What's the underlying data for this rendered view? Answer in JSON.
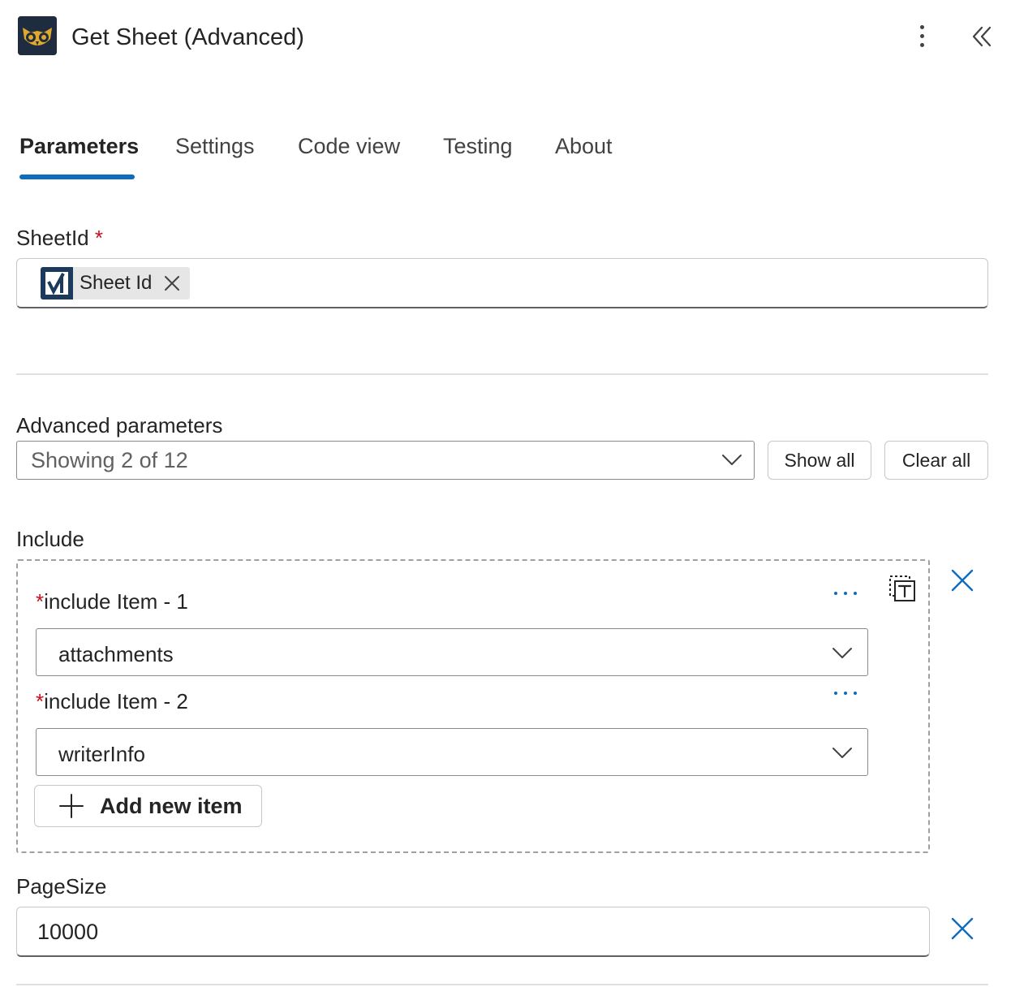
{
  "header": {
    "title": "Get Sheet (Advanced)",
    "app_icon": "owl-logo-icon",
    "more_icon": "more-vertical-icon",
    "collapse_icon": "double-chevron-left-icon"
  },
  "tabs": [
    {
      "label": "Parameters",
      "active": true
    },
    {
      "label": "Settings",
      "active": false
    },
    {
      "label": "Code view",
      "active": false
    },
    {
      "label": "Testing",
      "active": false
    },
    {
      "label": "About",
      "active": false
    }
  ],
  "sheet_id": {
    "label": "SheetId",
    "required_mark": "*",
    "token_label": "Sheet Id",
    "token_icon": "smartsheet-icon"
  },
  "advanced": {
    "label": "Advanced parameters",
    "dropdown_value": "Showing 2 of 12",
    "show_all_label": "Show all",
    "clear_all_label": "Clear all"
  },
  "include": {
    "label": "Include",
    "items": [
      {
        "required_mark": "*",
        "label": "include Item - 1",
        "value": "attachments"
      },
      {
        "required_mark": "*",
        "label": "include Item - 2",
        "value": "writerInfo"
      }
    ],
    "add_label": "Add new item"
  },
  "page_size": {
    "label": "PageSize",
    "value": "10000"
  },
  "colors": {
    "accent": "#0f6cbd",
    "required": "#c50f1f",
    "text": "#242424"
  }
}
